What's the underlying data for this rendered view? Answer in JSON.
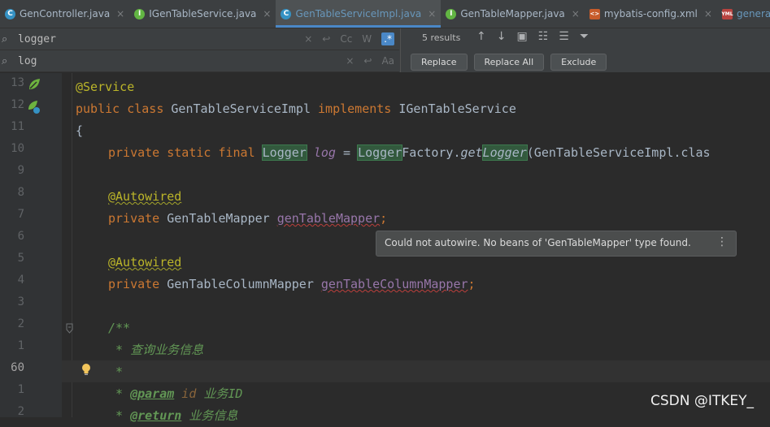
{
  "tabs": [
    {
      "icon": "C",
      "name": "GenController.java",
      "blue": false,
      "active": false
    },
    {
      "icon": "I",
      "name": "IGenTableService.java",
      "blue": false,
      "active": false
    },
    {
      "icon": "C",
      "name": "GenTableServiceImpl.java",
      "blue": true,
      "active": true
    },
    {
      "icon": "I",
      "name": "GenTableMapper.java",
      "blue": false,
      "active": false
    },
    {
      "icon": "X",
      "name": "mybatis-config.xml",
      "blue": false,
      "active": false
    },
    {
      "icon": "Y",
      "name": "generator.yml",
      "blue": true,
      "active": false
    }
  ],
  "find": {
    "search_value": "logger",
    "replace_value": "log",
    "results": "5 results",
    "case_label": "Cc",
    "word_label": "W",
    "regex_label": ".*",
    "replace_btn": "Replace",
    "replace_all_btn": "Replace All",
    "exclude_btn": "Exclude"
  },
  "gutter_numbers": [
    "13",
    "12",
    "11",
    "10",
    "9",
    "8",
    "7",
    "6",
    "5",
    "4",
    "3",
    "2",
    "1",
    "60",
    "1",
    "2"
  ],
  "code": {
    "l1": "@Service",
    "l2_kw": "public class",
    "l2_name": " GenTableServiceImpl ",
    "l2_impl": "implements",
    "l2_iface": " IGenTableService",
    "l3": "{",
    "l4_kw": "private static final",
    "l4_type": "Logger",
    "l4_var": "log",
    "l4_eq": " = ",
    "l4_factory1": "Logger",
    "l4_factory2": "Factory.",
    "l4_get": "get",
    "l4_get2": "Logger",
    "l4_rest": "(GenTableServiceImpl.clas",
    "l6": "@Autowired",
    "l7_kw": "private",
    "l7_type": " GenTableMapper ",
    "l7_field": "genTableMapper",
    "l7_semi": ";",
    "l9": "@Autowired",
    "l10_kw": "private",
    "l10_type": " GenTableColumnMapper ",
    "l10_field": "genTableColumnMapper",
    "l10_semi": ";",
    "l12": "/**",
    "l13": " * 查询业务信息",
    "l14": " *",
    "l15_star": " * ",
    "l15_tag": "@param",
    "l15_param": " id",
    "l15_desc": " 业务ID",
    "l16_star": " * ",
    "l16_tag": "@return",
    "l16_desc": " 业务信息"
  },
  "tooltip": {
    "text": "Could not autowire. No beans of 'GenTableMapper' type found.",
    "more": "⋮"
  },
  "watermark": "CSDN @ITKEY_",
  "colors": {
    "keyword": "#cc7832",
    "annotation": "#bbb529",
    "field": "#9876aa",
    "comment": "#629755",
    "highlight": "#32593d"
  }
}
